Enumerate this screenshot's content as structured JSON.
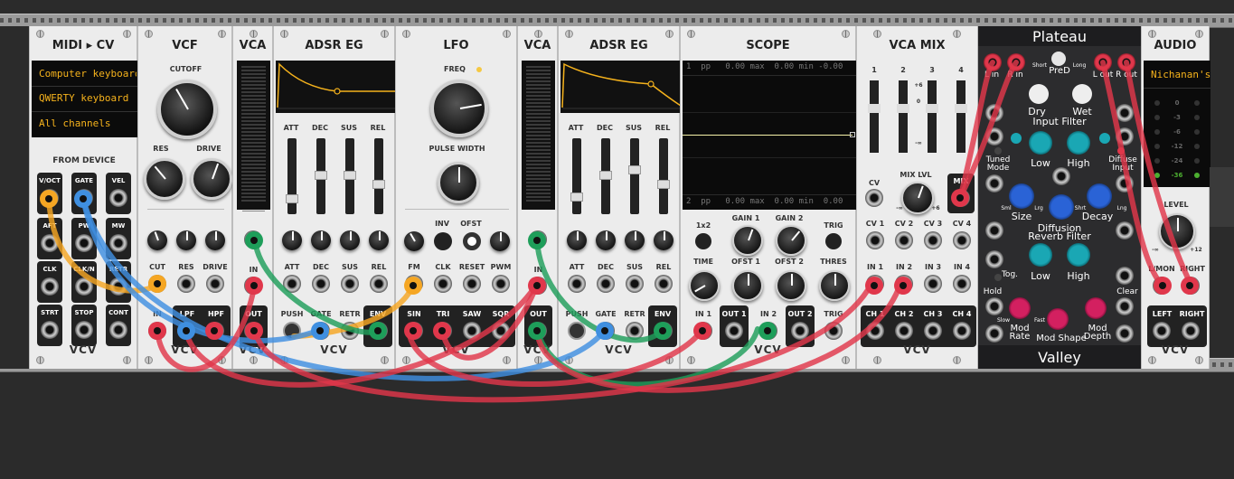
{
  "modules": {
    "midi_cv": {
      "title": "MIDI ▸ CV",
      "display_lines": [
        "Computer keyboard/m",
        "QWERTY keyboard (US",
        "All channels"
      ],
      "section_label": "FROM DEVICE",
      "jacks": [
        "V/OCT",
        "GATE",
        "VEL",
        "AFT",
        "PW",
        "MW",
        "CLK",
        "CLK/N",
        "RETR",
        "STRT",
        "STOP",
        "CONT"
      ],
      "brand": "VCV"
    },
    "vcf": {
      "title": "VCF",
      "knobs": [
        "CUTOFF",
        "RES",
        "DRIVE"
      ],
      "small_knobs": [
        "CUT",
        "RES",
        "DRIVE"
      ],
      "inputs": [
        "IN"
      ],
      "outputs": [
        "LPF",
        "HPF"
      ],
      "brand": "VCV"
    },
    "vca1": {
      "title": "VCA",
      "labels": [
        "IN",
        "OUT"
      ],
      "brand": "VCV"
    },
    "adsr1": {
      "title": "ADSR EG",
      "sliders": [
        "ATT",
        "DEC",
        "SUS",
        "REL"
      ],
      "cv_labels": [
        "ATT",
        "DEC",
        "SUS",
        "REL"
      ],
      "jacks": [
        "PUSH",
        "GATE",
        "RETR",
        "ENV"
      ],
      "brand": "VCV"
    },
    "lfo": {
      "title": "LFO",
      "freq_label": "FREQ",
      "pw_label": "PULSE WIDTH",
      "controls": [
        "INV",
        "OFST"
      ],
      "cv_labels": [
        "FM",
        "CLK",
        "RESET",
        "PWM"
      ],
      "outputs": [
        "SIN",
        "TRI",
        "SAW",
        "SQR"
      ],
      "brand": "VCV"
    },
    "vca2": {
      "title": "VCA",
      "labels": [
        "IN",
        "OUT"
      ],
      "brand": "VCV"
    },
    "adsr2": {
      "title": "ADSR EG",
      "sliders": [
        "ATT",
        "DEC",
        "SUS",
        "REL"
      ],
      "cv_labels": [
        "ATT",
        "DEC",
        "SUS",
        "REL"
      ],
      "jacks": [
        "PUSH",
        "GATE",
        "RETR",
        "ENV"
      ],
      "brand": "VCV"
    },
    "scope": {
      "title": "SCOPE",
      "ch1_readout": "1  pp   0.00 max  0.00 min -0.00",
      "ch2_readout": "2  pp   0.00 max  0.00 min  0.00",
      "controls": [
        "1x2",
        "GAIN 1",
        "GAIN 2",
        "TRIG",
        "TIME",
        "OFST 1",
        "OFST 2",
        "THRES"
      ],
      "jacks": [
        "IN 1",
        "OUT 1",
        "IN 2",
        "OUT 2",
        "TRIG"
      ],
      "brand": "VCV"
    },
    "vca_mix": {
      "title": "VCA MIX",
      "channels": [
        "1",
        "2",
        "3",
        "4"
      ],
      "fader_marks": [
        "+6",
        "0",
        "-∞"
      ],
      "cv_label": "CV",
      "mix_lvl": "MIX LVL",
      "mix_min": "-∞",
      "mix_max": "+6",
      "mix_out": "MIX",
      "cv_jacks": [
        "CV 1",
        "CV 2",
        "CV 3",
        "CV 4"
      ],
      "in_jacks": [
        "IN 1",
        "IN 2",
        "IN 3",
        "IN 4"
      ],
      "ch_jacks": [
        "CH 1",
        "CH 2",
        "CH 3",
        "CH 4"
      ],
      "brand": "VCV"
    },
    "plateau": {
      "title": "Plateau",
      "footer": "Valley",
      "labels": [
        "L in",
        "R in",
        "PreD",
        "Short",
        "Long",
        "L out",
        "R out",
        "Dry",
        "Wet",
        "Input Filter",
        "Tuned Mode",
        "Low",
        "High",
        "Diffuse Input",
        "Size",
        "Sml",
        "Lrg",
        "Diffusion",
        "Decay",
        "Shrt",
        "Lng",
        "Reverb Filter",
        "Tog.",
        "Low",
        "High",
        "Hold",
        "Clear",
        "Slow",
        "Fast",
        "Mod Rate",
        "Mod Shape",
        "Mod Depth"
      ]
    },
    "audio": {
      "title": "AUDIO",
      "device": "Nichanan's",
      "meter_labels": [
        "0",
        "-3",
        "-6",
        "-12",
        "-24",
        "-36"
      ],
      "level_label": "LEVEL",
      "level_min": "-∞",
      "level_max": "+12",
      "in_labels": [
        "L/MON",
        "RIGHT"
      ],
      "out_labels": [
        "LEFT",
        "RIGHT"
      ],
      "brand": "VCV"
    }
  },
  "colors": {
    "orange": "#f5a623",
    "blue": "#3f8fe0",
    "green": "#1e9e5a",
    "red": "#e0374b",
    "teal": "#14a7b4",
    "royal": "#2a63d6",
    "magenta": "#d32060",
    "display_text": "#f5b21c"
  }
}
